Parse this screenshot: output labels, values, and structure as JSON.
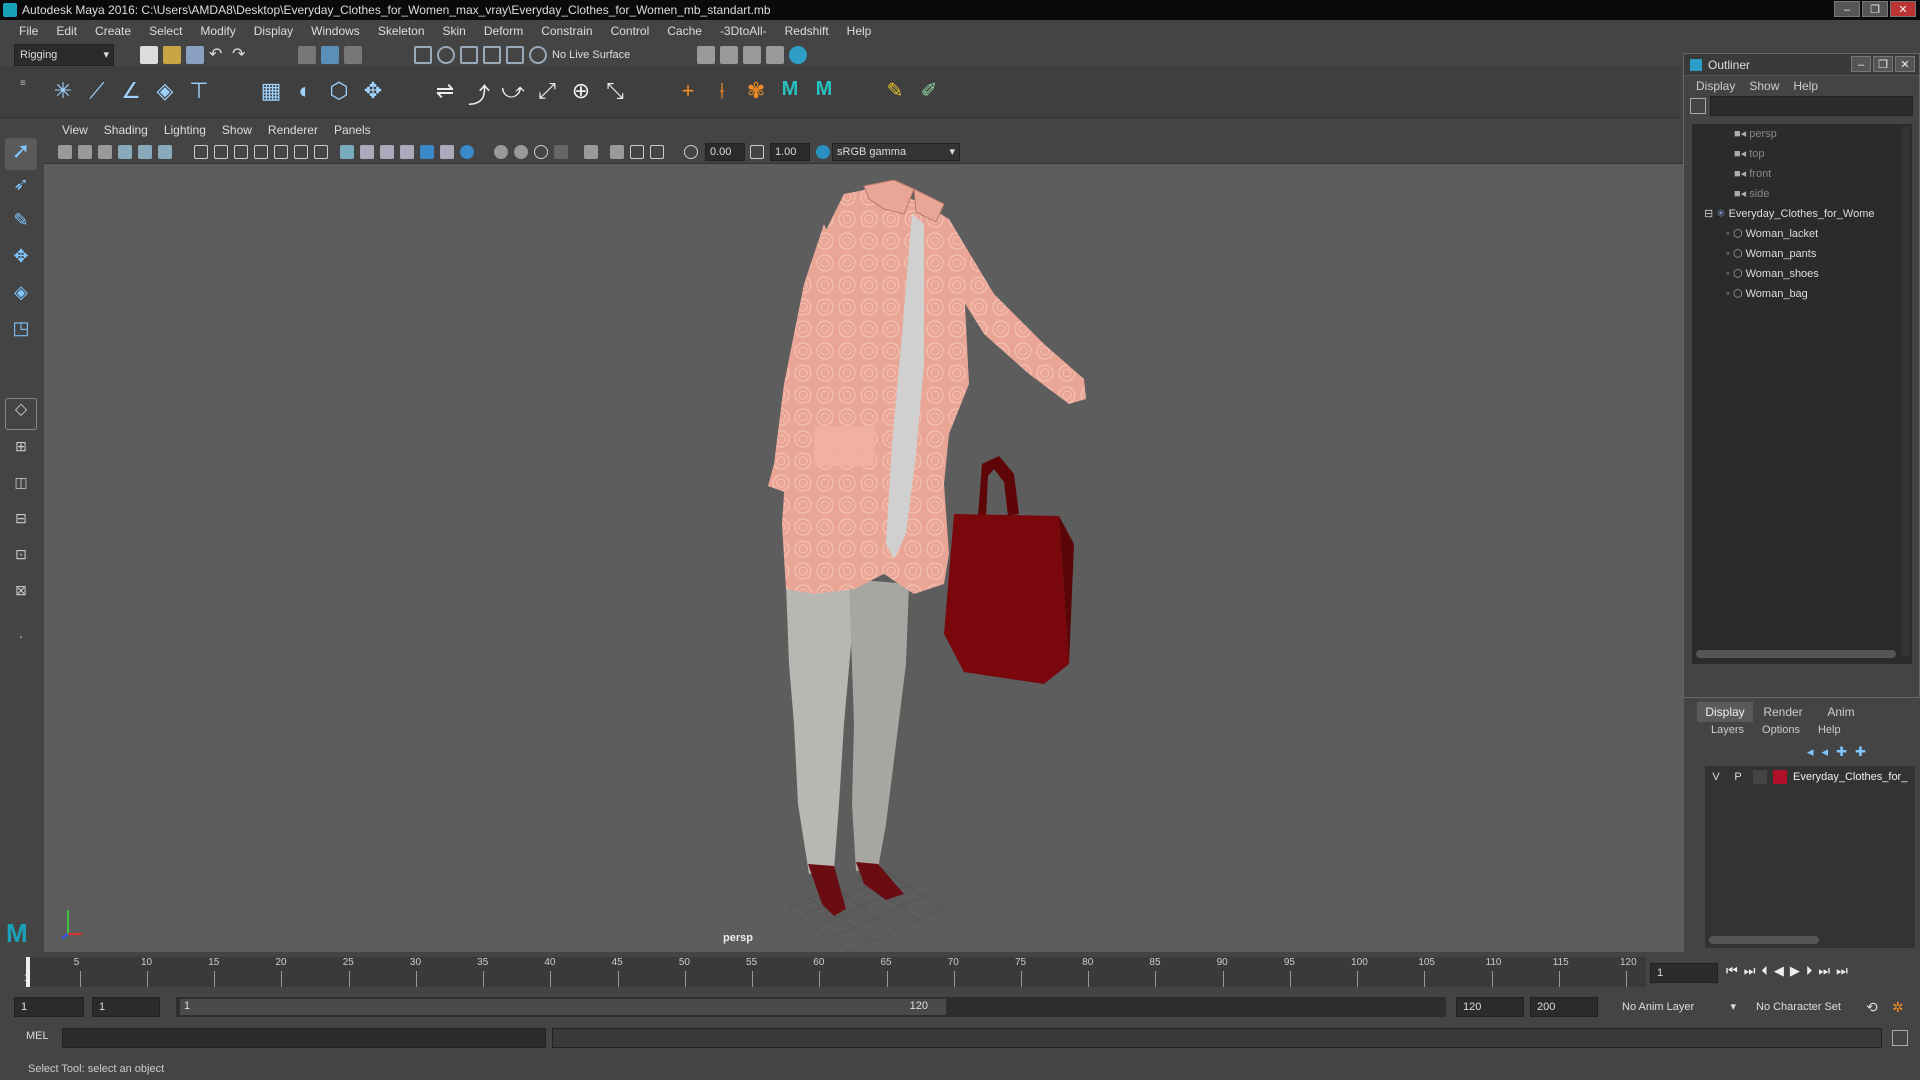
{
  "app": {
    "title": "Autodesk Maya 2016: C:\\Users\\AMDA8\\Desktop\\Everyday_Clothes_for_Women_max_vray\\Everyday_Clothes_for_Women_mb_standart.mb"
  },
  "menubar": [
    "File",
    "Edit",
    "Create",
    "Select",
    "Modify",
    "Display",
    "Windows",
    "Skeleton",
    "Skin",
    "Deform",
    "Constrain",
    "Control",
    "Cache",
    "-3DtoAll-",
    "Redshift",
    "Help"
  ],
  "statusline": {
    "mode": "Rigging",
    "live_surface": "No Live Surface"
  },
  "viewport": {
    "menu": [
      "View",
      "Shading",
      "Lighting",
      "Show",
      "Renderer",
      "Panels"
    ],
    "exposure": "0.00",
    "gamma": "1.00",
    "color_space": "sRGB gamma",
    "camera_label": "persp"
  },
  "outliner": {
    "title": "Outliner",
    "menu": [
      "Display",
      "Show",
      "Help"
    ],
    "items": [
      {
        "label": "persp",
        "kind": "camera"
      },
      {
        "label": "top",
        "kind": "camera"
      },
      {
        "label": "front",
        "kind": "camera"
      },
      {
        "label": "side",
        "kind": "camera"
      },
      {
        "label": "Everyday_Clothes_for_Wome",
        "kind": "group"
      },
      {
        "label": "Woman_lacket",
        "kind": "mesh"
      },
      {
        "label": "Woman_pants",
        "kind": "mesh"
      },
      {
        "label": "Woman_shoes",
        "kind": "mesh"
      },
      {
        "label": "Woman_bag",
        "kind": "mesh"
      }
    ]
  },
  "layers": {
    "tabs": [
      "Display",
      "Render",
      "Anim"
    ],
    "menu": [
      "Layers",
      "Options",
      "Help"
    ],
    "layer": {
      "v": "V",
      "p": "P",
      "name": "Everyday_Clothes_for_",
      "color": "#b0102a"
    }
  },
  "timeline": {
    "ticks": [
      "5",
      "10",
      "15",
      "20",
      "25",
      "30",
      "35",
      "40",
      "45",
      "50",
      "55",
      "60",
      "65",
      "70",
      "75",
      "80",
      "85",
      "90",
      "95",
      "100",
      "105",
      "110",
      "115",
      "120"
    ],
    "start_label": "1",
    "current_frame": "1"
  },
  "range": {
    "start": "1",
    "playback_start": "1",
    "slider_start": "1",
    "slider_end": "120",
    "playback_end": "120",
    "end": "200",
    "anim_layer": "No Anim Layer",
    "char_set": "No Character Set"
  },
  "cmd": {
    "lang": "MEL"
  },
  "help": {
    "text": "Select Tool: select an object"
  }
}
